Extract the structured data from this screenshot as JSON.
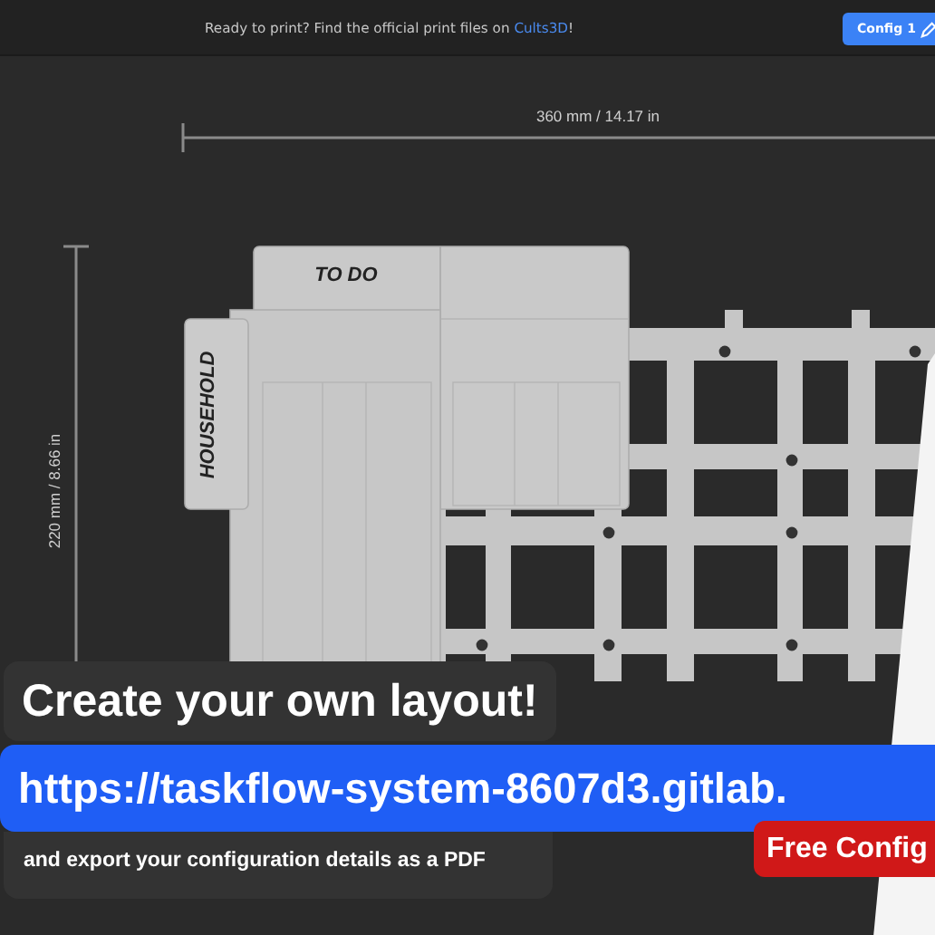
{
  "top_bar": {
    "message": "Ready to print? Find the official print files on ",
    "link": "Cults3D",
    "message_end": "!",
    "config_button": {
      "label": "Config 1"
    }
  },
  "canvas": {
    "width_dimension": "360 mm / 14.17 in",
    "height_dimension": "220 mm / 8.66 in",
    "bins": [
      {
        "label": "TO DO",
        "kind": "horizontal"
      },
      {
        "label": "HOUSEHOLD",
        "kind": "vertical"
      }
    ]
  },
  "promo": {
    "headline": "Create your own layout!",
    "url": "https://taskflow-system-8607d3.gitlab.",
    "subtitle": "and export your configuration details as a PDF",
    "badge": "Free Config"
  }
}
